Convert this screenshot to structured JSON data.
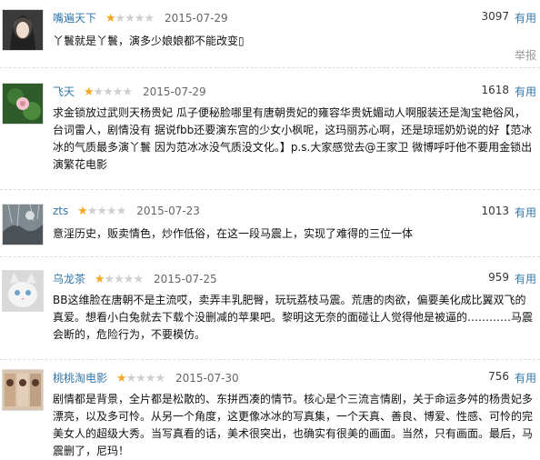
{
  "reviews": [
    {
      "user": "嘴遍天下",
      "stars_filled": 1,
      "date": "2015-07-29",
      "votes": "3097",
      "useful_label": "有用",
      "text": "丫鬟就是丫鬟，演多少娘娘都不能改变▯",
      "report_label": "举报"
    },
    {
      "user": "飞天",
      "stars_filled": 1,
      "date": "2015-07-29",
      "votes": "1618",
      "useful_label": "有用",
      "text": "求金锁放过武则天杨贵妃 瓜子便秘脸哪里有唐朝贵妃的雍容华贵妩媚动人啊服装还是淘宝艳俗风，台词雷人，剧情没有 据说fbb还要演东宫的少女小枫呢，这玛丽苏心啊，还是琼瑶奶奶说的好【范冰冰的气质最多演丫鬟 因为范冰冰没气质没文化。】p.s.大家感觉去@王家卫 微博呼吁他不要用金锁出演繁花电影"
    },
    {
      "user": "zts",
      "stars_filled": 1,
      "date": "2015-07-23",
      "votes": "1013",
      "useful_label": "有用",
      "text": "意淫历史，贩卖情色，炒作低俗，在这一段马震上，实现了难得的三位一体"
    },
    {
      "user": "乌龙茶",
      "stars_filled": 1,
      "date": "2015-07-25",
      "votes": "959",
      "useful_label": "有用",
      "text": "BB这维脸在唐朝不是主流哎，卖弄丰乳肥臀，玩玩荔枝马震。荒唐的肉欲，偏要美化成比翼双飞的真爱。想看小白兔就去下载个没删减的苹果吧。黎明这无奈的面碰让人觉得他是被逼的…………马震会断的，危险行为，不要模仿。"
    },
    {
      "user": "桃桃淘电影",
      "stars_filled": 1,
      "date": "2015-07-30",
      "votes": "756",
      "useful_label": "有用",
      "text": "剧情都是背景，全片都是松散的、东拼西凑的情节。核心是个三流言情剧，关于命运多舛的杨贵妃多漂亮，以及多可怜。从另一个角度，这更像冰冰的写真集，一个天真、善良、博爱、性感、可怜的完美女人的超级大秀。当写真看的话，美术很突出，也确实有很美的画面。当然，只有画面。最后，马震删了，尼玛！"
    }
  ]
}
